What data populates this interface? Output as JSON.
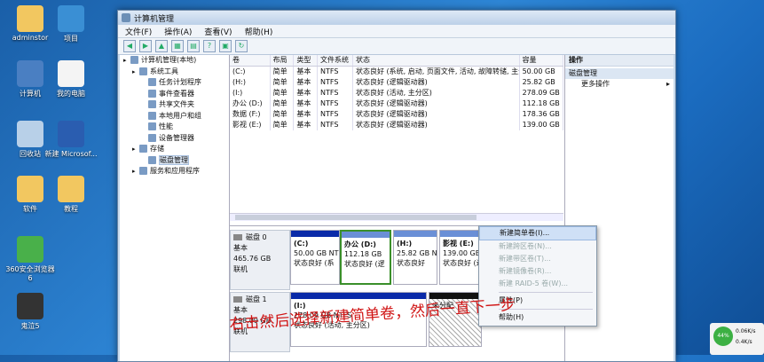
{
  "desktop": {
    "icons": [
      {
        "label": "adminstor",
        "color": "#f2c760"
      },
      {
        "label": "项目",
        "color": "#3a8fd4"
      },
      {
        "label": "计算机",
        "color": "#4a7fc2"
      },
      {
        "label": "我的电脑",
        "color": "#f4f4f4"
      },
      {
        "label": "回收站",
        "color": "#b8d0e8"
      },
      {
        "label": "新建 Microsof...",
        "color": "#2a5db0"
      },
      {
        "label": "软件",
        "color": "#f2c760"
      },
      {
        "label": "教程",
        "color": "#f2c760"
      },
      {
        "label": "360安全浏览器6",
        "color": "#49b04a"
      },
      {
        "label": "鬼泣5",
        "color": "#333333"
      }
    ]
  },
  "window": {
    "title": "计算机管理",
    "menu": [
      "文件(F)",
      "操作(A)",
      "查看(V)",
      "帮助(H)"
    ],
    "toolbar": [
      "back-arrow-icon",
      "forward-arrow-icon",
      "up-folder-icon",
      "show-tree-icon",
      "properties-icon",
      "help-icon",
      "export-icon",
      "refresh-icon"
    ]
  },
  "tree": [
    {
      "label": "计算机管理(本地)",
      "level": 0,
      "icon": "computer-icon"
    },
    {
      "label": "系统工具",
      "level": 1,
      "icon": "tools-icon"
    },
    {
      "label": "任务计划程序",
      "level": 2,
      "icon": "clock-icon"
    },
    {
      "label": "事件查看器",
      "level": 2,
      "icon": "event-icon"
    },
    {
      "label": "共享文件夹",
      "level": 2,
      "icon": "folder-share-icon"
    },
    {
      "label": "本地用户和组",
      "level": 2,
      "icon": "users-icon"
    },
    {
      "label": "性能",
      "level": 2,
      "icon": "performance-icon"
    },
    {
      "label": "设备管理器",
      "level": 2,
      "icon": "device-icon"
    },
    {
      "label": "存储",
      "level": 1,
      "icon": "storage-icon"
    },
    {
      "label": "磁盘管理",
      "level": 2,
      "icon": "disk-icon",
      "selected": true
    },
    {
      "label": "服务和应用程序",
      "level": 1,
      "icon": "services-icon"
    }
  ],
  "volumes": {
    "headers": [
      "卷",
      "布局",
      "类型",
      "文件系统",
      "状态",
      "容量"
    ],
    "rows": [
      [
        "(C:)",
        "简单",
        "基本",
        "NTFS",
        "状态良好 (系统, 启动, 页面文件, 活动, 故障转储, 主分区)",
        "50.00 GB"
      ],
      [
        "(H:)",
        "简单",
        "基本",
        "NTFS",
        "状态良好 (逻辑驱动器)",
        "25.82 GB"
      ],
      [
        "(I:)",
        "简单",
        "基本",
        "NTFS",
        "状态良好 (活动, 主分区)",
        "278.09 GB"
      ],
      [
        "办公 (D:)",
        "简单",
        "基本",
        "NTFS",
        "状态良好 (逻辑驱动器)",
        "112.18 GB"
      ],
      [
        "数据 (F:)",
        "简单",
        "基本",
        "NTFS",
        "状态良好 (逻辑驱动器)",
        "178.36 GB"
      ],
      [
        "影视 (E:)",
        "简单",
        "基本",
        "NTFS",
        "状态良好 (逻辑驱动器)",
        "139.00 GB"
      ]
    ]
  },
  "disks": [
    {
      "name": "磁盘 0",
      "type": "基本",
      "size": "465.76 GB",
      "status": "联机",
      "parts": [
        {
          "title": "(C:)",
          "line2": "50.00 GB NT",
          "line3": "状态良好 (系",
          "sel": false,
          "hatch": false,
          "logical": false
        },
        {
          "title": "办公 (D:)",
          "line2": "112.18 GB",
          "line3": "状态良好 (逻",
          "sel": true,
          "hatch": false,
          "logical": true
        },
        {
          "title": "(H:)",
          "line2": "25.82 GB N",
          "line3": "状态良好",
          "sel": false,
          "hatch": false,
          "logical": true
        },
        {
          "title": "影视 (E:)",
          "line2": "139.00 GB",
          "line3": "状态良好 (逻",
          "sel": false,
          "hatch": false,
          "logical": true
        }
      ]
    },
    {
      "name": "磁盘 1",
      "type": "基本",
      "size": "298.09 GB",
      "status": "联机",
      "parts": [
        {
          "title": "(I:)",
          "line2": "278.09 GB NTFS",
          "line3": "状态良好 (活动, 主分区)",
          "sel": false,
          "hatch": false,
          "logical": false
        },
        {
          "title": "",
          "line2": "",
          "line3": "未分配",
          "sel": false,
          "hatch": true,
          "logical": false
        }
      ]
    }
  ],
  "actions": {
    "header": "操作",
    "section": "磁盘管理",
    "items": [
      "更多操作"
    ]
  },
  "context_menu": [
    {
      "label": "新建简单卷(I)...",
      "disabled": false,
      "highlight": true
    },
    {
      "label": "新建跨区卷(N)...",
      "disabled": true
    },
    {
      "label": "新建带区卷(T)...",
      "disabled": true
    },
    {
      "label": "新建镜像卷(R)...",
      "disabled": true
    },
    {
      "label": "新建 RAID-5 卷(W)...",
      "disabled": true
    },
    {
      "sep": true
    },
    {
      "label": "属性(P)",
      "disabled": false
    },
    {
      "sep": true
    },
    {
      "label": "帮助(H)",
      "disabled": false
    }
  ],
  "annotation": "右击然后选择新建简单卷，然后一直下一步",
  "tray": {
    "gauge": "44%",
    "up": "0.06K/s",
    "down": "0.4K/s"
  }
}
